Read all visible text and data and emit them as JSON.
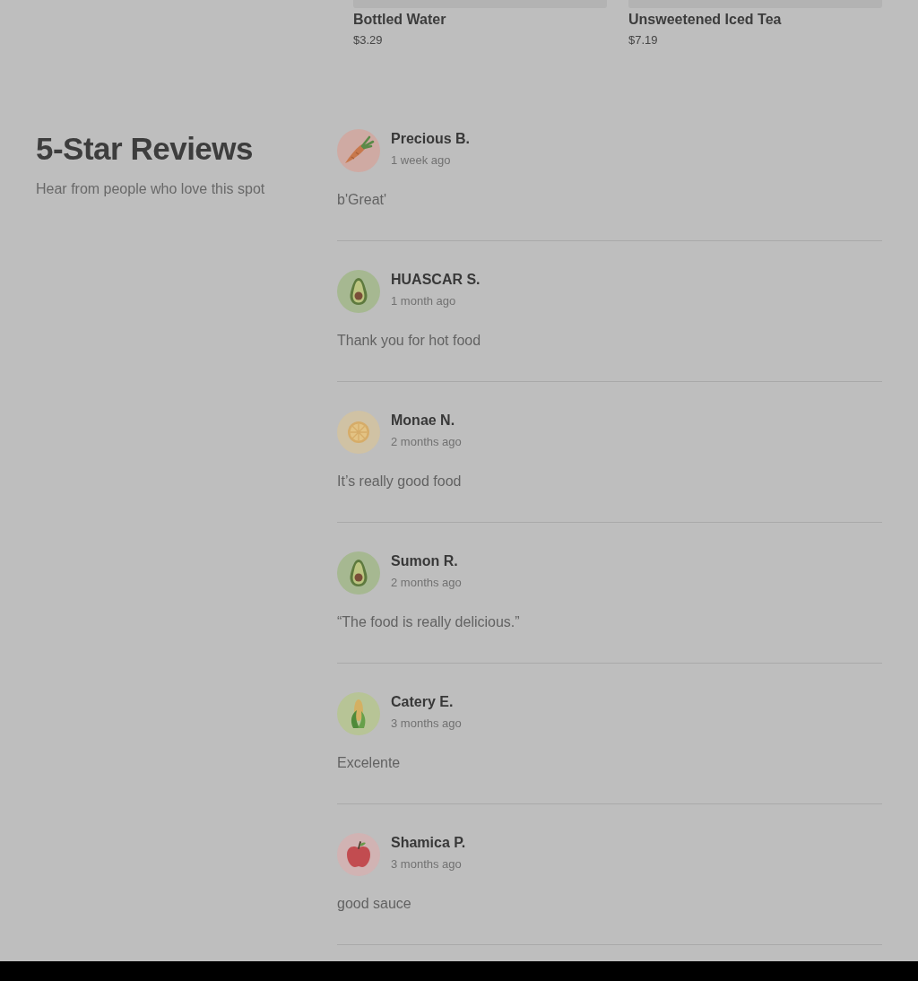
{
  "products": [
    {
      "name": "Bottled Water",
      "price": "$3.29"
    },
    {
      "name": "Unsweetened Iced Tea",
      "price": "$7.19"
    }
  ],
  "reviews_section": {
    "title": "5-Star Reviews",
    "subtitle": "Hear from people who love this spot"
  },
  "reviews": [
    {
      "author": "Precious B.",
      "time": "1 week ago",
      "text": "b'Great'",
      "avatar": {
        "kind": "carrot"
      }
    },
    {
      "author": "HUASCAR S.",
      "time": "1 month ago",
      "text": "Thank you for hot food",
      "avatar": {
        "kind": "avocado"
      }
    },
    {
      "author": "Monae N.",
      "time": "2 months ago",
      "text": "It’s really good food",
      "avatar": {
        "kind": "citrus"
      }
    },
    {
      "author": "Sumon R.",
      "time": "2 months ago",
      "text": "“The food is really delicious.”",
      "avatar": {
        "kind": "avocado"
      }
    },
    {
      "author": "Catery E.",
      "time": "3 months ago",
      "text": "Excelente",
      "avatar": {
        "kind": "corn"
      }
    },
    {
      "author": "Shamica P.",
      "time": "3 months ago",
      "text": "good sauce",
      "avatar": {
        "kind": "apple"
      }
    }
  ]
}
